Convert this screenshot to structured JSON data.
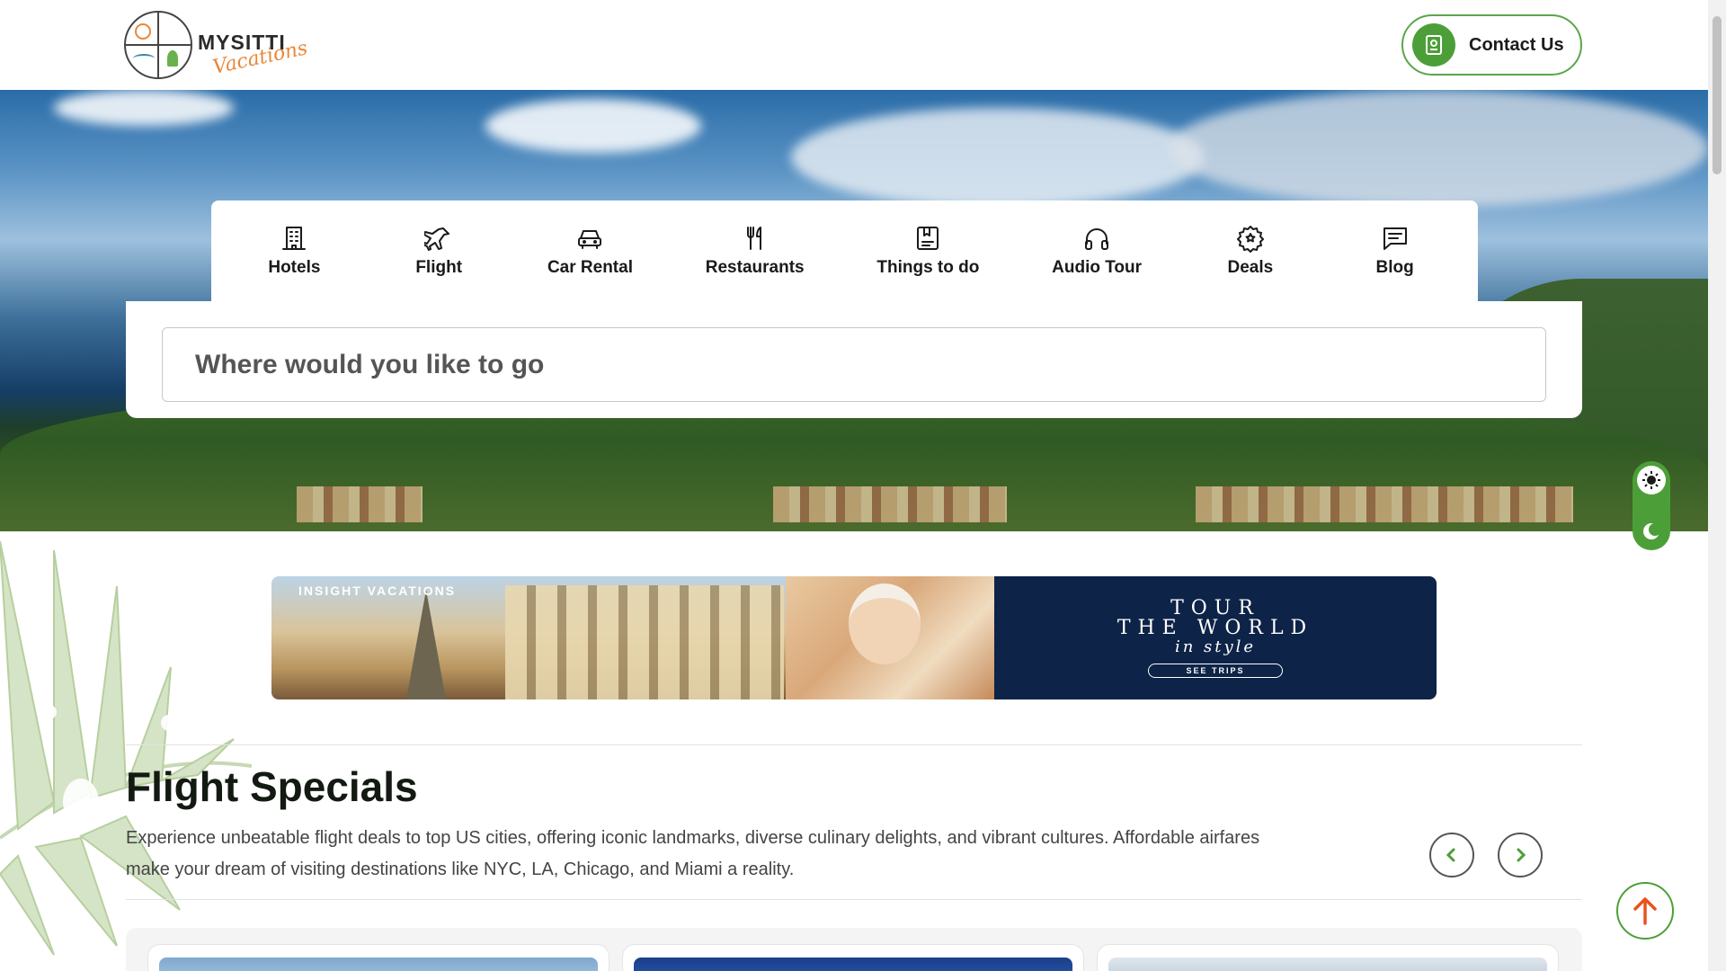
{
  "header": {
    "logo": {
      "wordmark": "MYSITTI",
      "script": "Vacations"
    },
    "contact_label": "Contact Us"
  },
  "tabs": [
    {
      "label": "Hotels",
      "icon": "building-icon"
    },
    {
      "label": "Flight",
      "icon": "plane-icon"
    },
    {
      "label": "Car Rental",
      "icon": "car-icon"
    },
    {
      "label": "Restaurants",
      "icon": "fork-knife-icon"
    },
    {
      "label": "Things to do",
      "icon": "bookmark-list-icon"
    },
    {
      "label": "Audio Tour",
      "icon": "headphones-icon"
    },
    {
      "label": "Deals",
      "icon": "badge-star-icon"
    },
    {
      "label": "Blog",
      "icon": "chat-text-icon"
    }
  ],
  "search": {
    "placeholder": "Where would you like to go"
  },
  "ad": {
    "brand": "INSIGHT VACATIONS",
    "line1": "TOUR",
    "line2": "THE WORLD",
    "line3": "in style",
    "cta": "SEE TRIPS"
  },
  "section": {
    "title": "Flight Specials",
    "description": "Experience unbeatable flight deals to top US cities, offering iconic landmarks, diverse culinary delights, and vibrant cultures. Affordable airfares make your dream of visiting destinations like NYC, LA, Chicago, and Miami a reality."
  },
  "colors": {
    "accent_green": "#4c9f38",
    "scroll_top_arrow": "#e8531f",
    "ad_panel": "#0d2347"
  },
  "icons": {
    "theme_light": "sun-icon",
    "theme_dark": "moon-icon",
    "scroll_top": "arrow-up-icon",
    "prev": "chevron-left-icon",
    "next": "chevron-right-icon",
    "contact": "contact-card-icon"
  }
}
